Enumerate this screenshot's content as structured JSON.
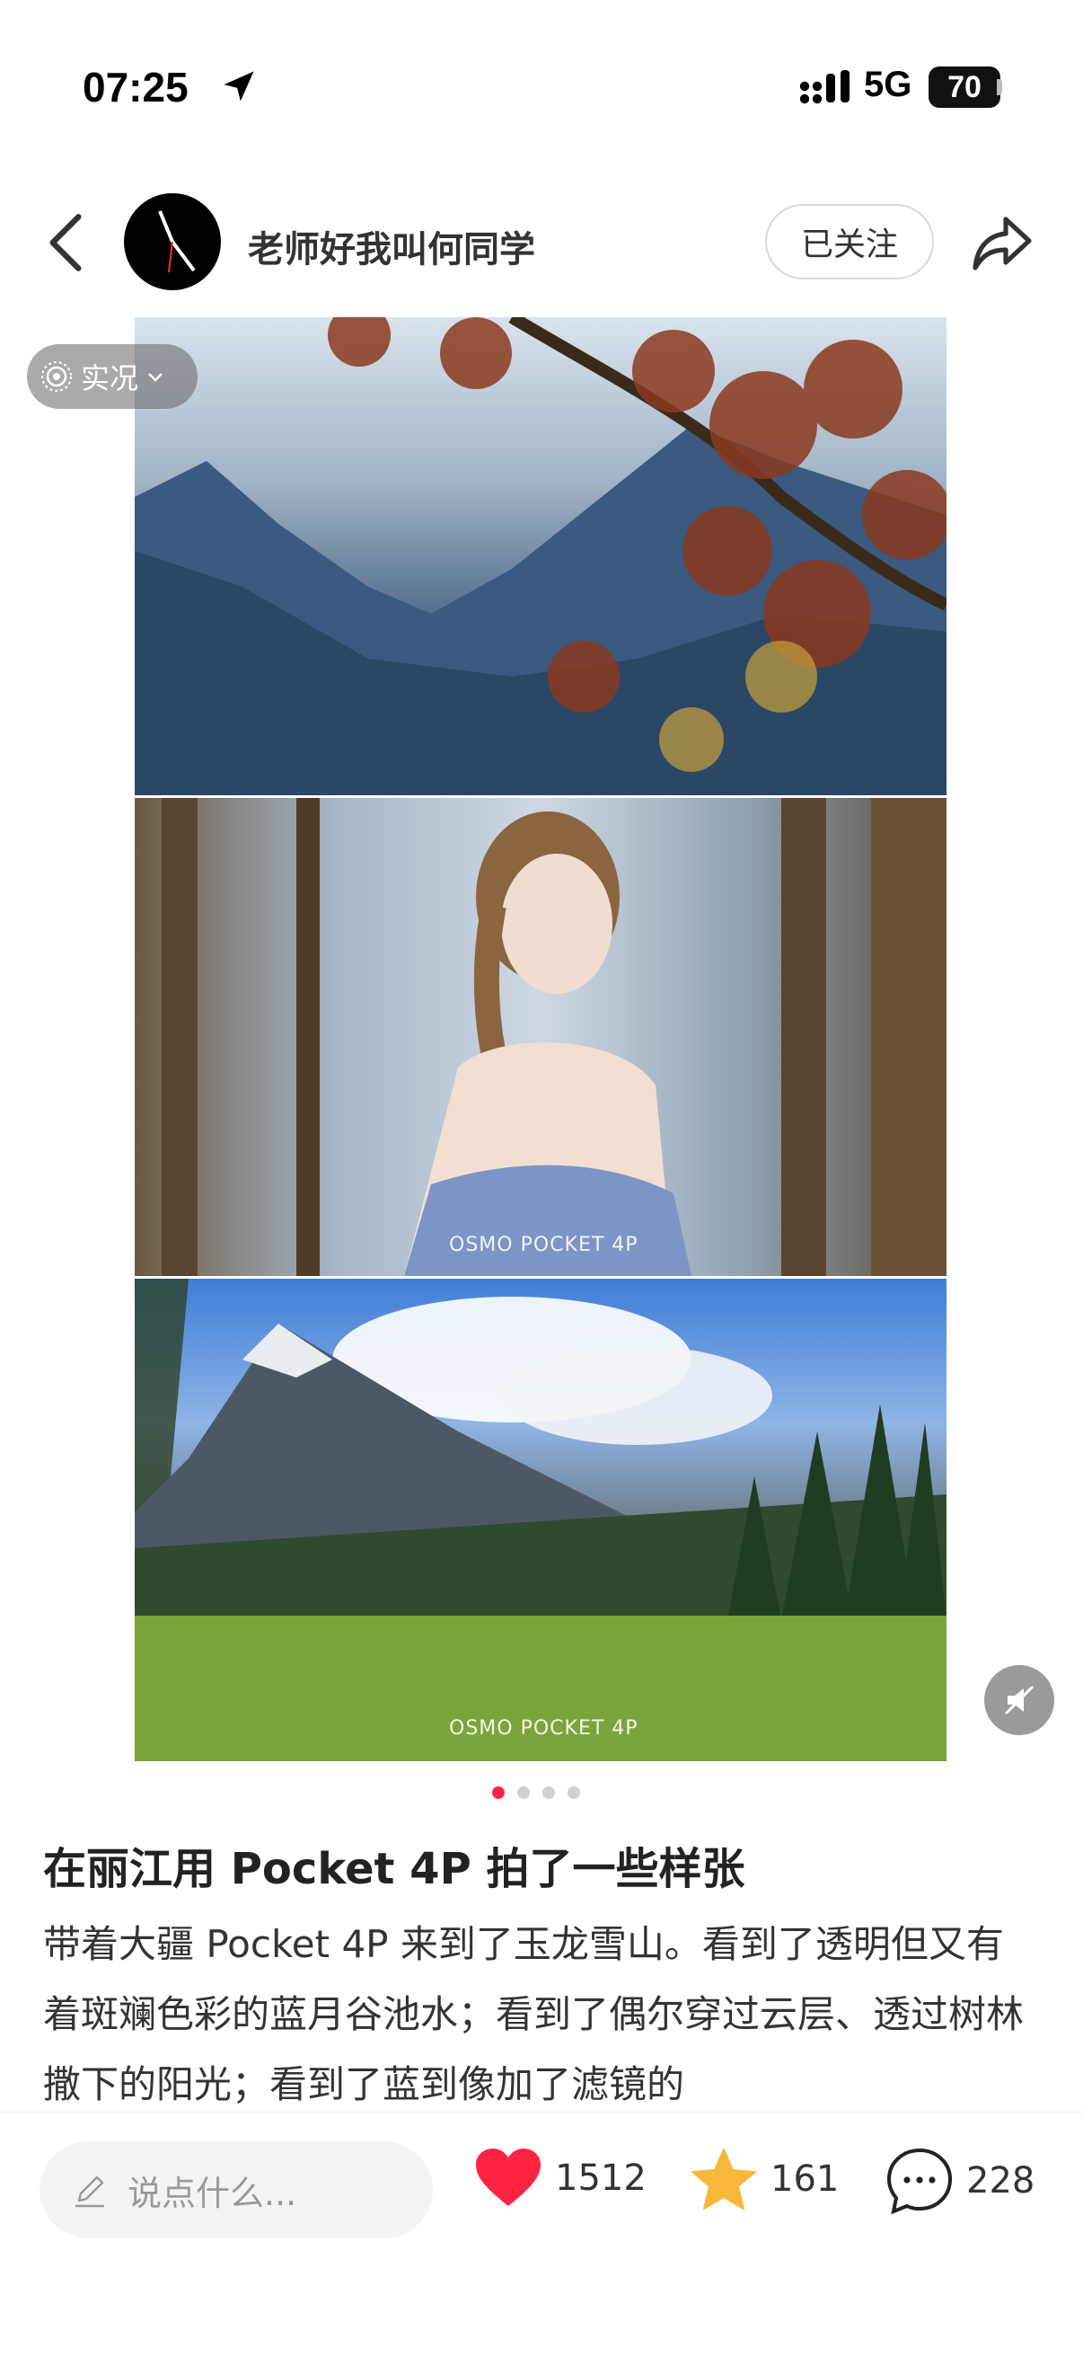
{
  "status_bar": {
    "time": "07:25",
    "network": "5G",
    "battery": "70"
  },
  "header": {
    "author": "老师好我叫何同学",
    "follow_label": "已关注"
  },
  "media": {
    "live_label": "实况",
    "watermarks": [
      "OSMO POCKET 4P",
      "OSMO POCKET 4P"
    ],
    "page_count": 4,
    "current_page": 1
  },
  "post": {
    "title": "在丽江用 Pocket 4P 拍了一些样张",
    "body": "带着大疆 Pocket 4P 来到了玉龙雪山。看到了透明但又有着斑斓色彩的蓝月谷池水；看到了偶尔穿过云层、透过树林撒下的阳光；看到了蓝到像加了滤镜的"
  },
  "bottom_bar": {
    "comment_placeholder": "说点什么...",
    "likes": "1512",
    "favorites": "161",
    "comments": "228"
  },
  "colors": {
    "accent": "#ff2442",
    "star": "#f7b83a"
  },
  "icons": [
    "location-arrow-icon",
    "signal-icon",
    "back-icon",
    "share-icon",
    "live-photo-icon",
    "chevron-down-icon",
    "mute-icon",
    "pencil-icon",
    "heart-icon",
    "star-icon",
    "comment-icon"
  ]
}
